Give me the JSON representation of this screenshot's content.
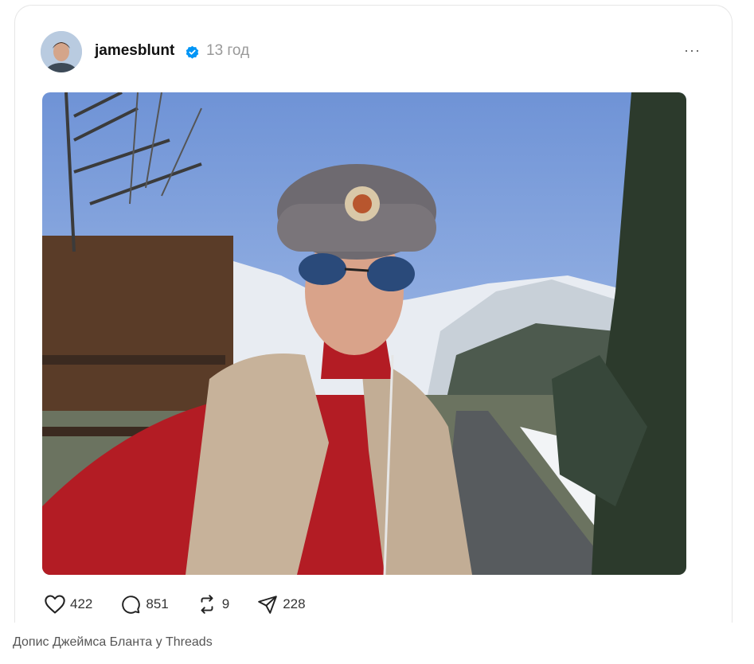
{
  "post": {
    "author": "jamesblunt",
    "time": "13 год",
    "more_label": "···",
    "image_alt": "Selfie in a fur hat with sunglasses on a snowy mountain road"
  },
  "actions": {
    "likes": "422",
    "replies": "851",
    "reposts": "9",
    "shares": "228"
  },
  "caption": "Допис Джеймса Бланта у Threads",
  "colors": {
    "verified": "#0095f6",
    "muted": "#999999"
  }
}
